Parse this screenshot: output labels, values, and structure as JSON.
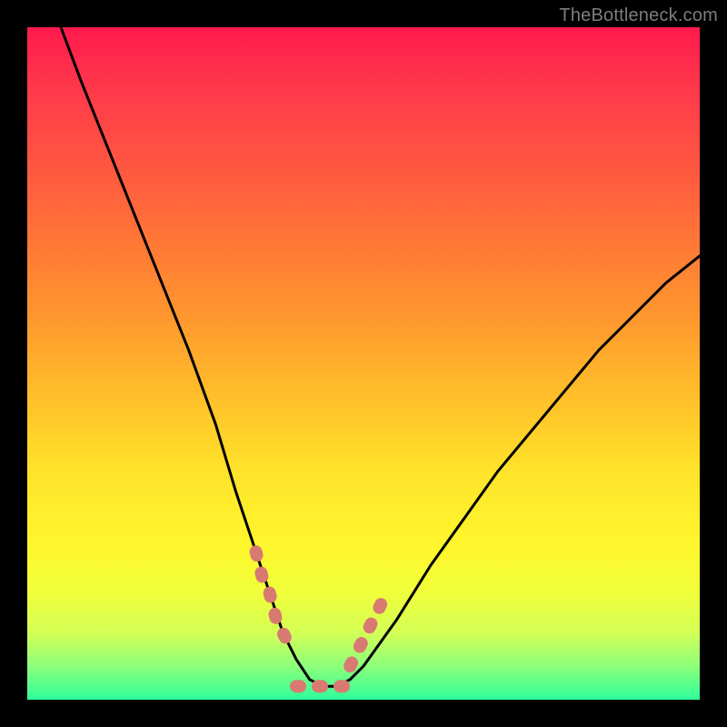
{
  "watermark": "TheBottleneck.com",
  "chart_data": {
    "type": "line",
    "title": "",
    "xlabel": "",
    "ylabel": "",
    "xlim": [
      0,
      100
    ],
    "ylim": [
      0,
      100
    ],
    "grid": false,
    "series": [
      {
        "name": "bottleneck-curve",
        "x": [
          5,
          8,
          12,
          16,
          20,
          24,
          28,
          31,
          34,
          36,
          38,
          40,
          42,
          44,
          46,
          48,
          50,
          55,
          60,
          65,
          70,
          75,
          80,
          85,
          90,
          95,
          100
        ],
        "y": [
          100,
          92,
          82,
          72,
          62,
          52,
          41,
          31,
          22,
          16,
          10,
          6,
          3,
          2,
          2,
          3,
          5,
          12,
          20,
          27,
          34,
          40,
          46,
          52,
          57,
          62,
          66
        ]
      },
      {
        "name": "marker-band-left",
        "x": [
          34,
          35,
          36,
          37,
          38,
          39
        ],
        "y": [
          22,
          18,
          16,
          12,
          10,
          8
        ]
      },
      {
        "name": "marker-band-bottom",
        "x": [
          40,
          42,
          44,
          46,
          48
        ],
        "y": [
          2,
          2,
          2,
          2,
          2
        ]
      },
      {
        "name": "marker-band-right",
        "x": [
          48,
          49,
          50,
          51,
          52,
          53
        ],
        "y": [
          5,
          7,
          9,
          11,
          13,
          15
        ]
      }
    ]
  }
}
